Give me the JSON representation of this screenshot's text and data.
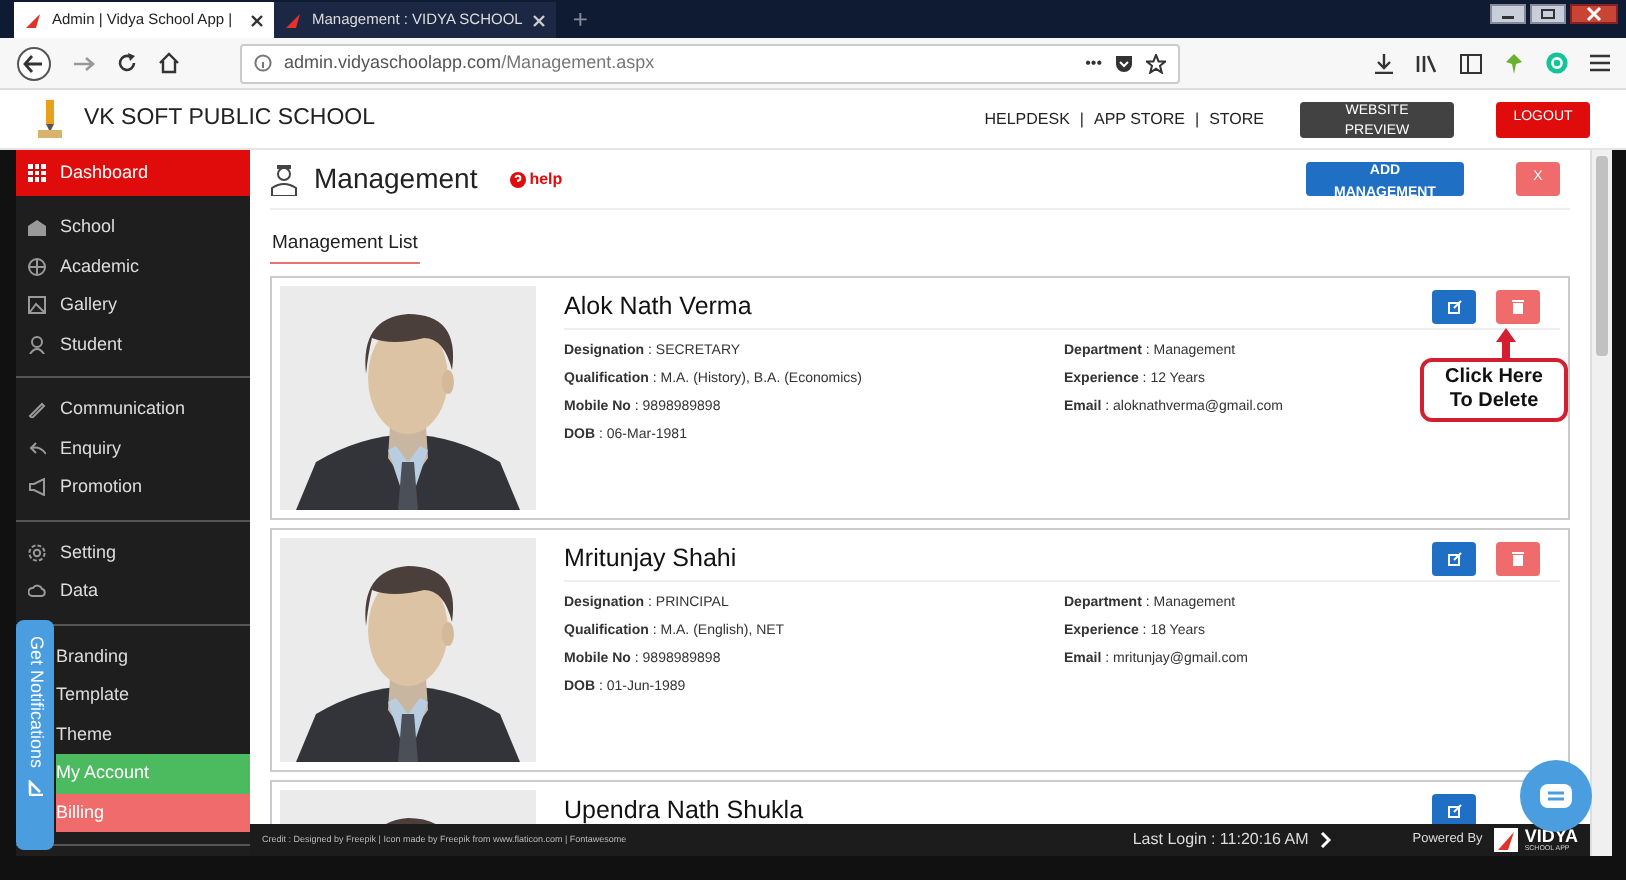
{
  "browser": {
    "tabs": [
      {
        "title": "Admin | Vidya School App |",
        "selected": true
      },
      {
        "title": "Management : VIDYA SCHOOL",
        "selected": false
      }
    ],
    "new_tab": "+",
    "url_host": "admin.vidyaschoolapp.com",
    "url_path": "/Management.aspx",
    "url_dots": "•••"
  },
  "header": {
    "school_name": "VK SOFT PUBLIC SCHOOL",
    "links": [
      "HELPDESK",
      "APP STORE",
      "STORE"
    ],
    "separator": "|",
    "preview_button": "WEBSITE PREVIEW",
    "logout_button": "LOGOUT"
  },
  "sidebar": {
    "groups": [
      [
        {
          "label": "Dashboard",
          "selected": true
        }
      ],
      [
        {
          "label": "School",
          "selected": false
        },
        {
          "label": "Academic",
          "selected": false
        },
        {
          "label": "Gallery",
          "selected": false
        },
        {
          "label": "Student",
          "selected": false
        }
      ],
      [
        {
          "label": "Communication",
          "selected": false
        },
        {
          "label": "Enquiry",
          "selected": false
        },
        {
          "label": "Promotion",
          "selected": false
        }
      ],
      [
        {
          "label": "Setting",
          "selected": false
        },
        {
          "label": "Data",
          "selected": false
        }
      ],
      [
        {
          "label": "Branding",
          "selected": false
        },
        {
          "label": "Template",
          "selected": false
        },
        {
          "label": "Theme",
          "selected": false
        },
        {
          "label": "My Account",
          "selected": false,
          "color": "#4cbb5f"
        },
        {
          "label": "Billing",
          "selected": false,
          "color": "#f06b6b"
        }
      ]
    ]
  },
  "notifications_tab": "Get Notifications",
  "page": {
    "title": "Management",
    "help": "help",
    "add_button": "ADD MANAGEMENT",
    "close_button": "X",
    "section": "Management List",
    "members": [
      {
        "name": "Alok Nath Verma",
        "left": [
          {
            "label": "Designation",
            "value": "SECRETARY"
          },
          {
            "label": "Qualification",
            "value": "M.A. (History), B.A. (Economics)"
          },
          {
            "label": "Mobile No",
            "value": "9898989898"
          },
          {
            "label": "DOB",
            "value": "06-Mar-1981"
          }
        ],
        "right": [
          {
            "label": "Department",
            "value": "Management"
          },
          {
            "label": "Experience",
            "value": "12 Years"
          },
          {
            "label": "Email",
            "value": "aloknathverma@gmail.com"
          }
        ],
        "callout": "Click Here To Delete"
      },
      {
        "name": "Mritunjay Shahi",
        "left": [
          {
            "label": "Designation",
            "value": "PRINCIPAL"
          },
          {
            "label": "Qualification",
            "value": "M.A. (English), NET"
          },
          {
            "label": "Mobile No",
            "value": "9898989898"
          },
          {
            "label": "DOB",
            "value": "01-Jun-1989"
          }
        ],
        "right": [
          {
            "label": "Department",
            "value": "Management"
          },
          {
            "label": "Experience",
            "value": "18 Years"
          },
          {
            "label": "Email",
            "value": "mritunjay@gmail.com"
          }
        ]
      },
      {
        "name": "Upendra Nath Shukla"
      }
    ],
    "field_separator": ":"
  },
  "footer": {
    "credit": "Credit : Designed by Freepik | Icon made by Freepik from www.flaticon.com | Fontawesome",
    "last_login": "Last Login : 11:20:16 AM",
    "powered_by": "Powered By",
    "logo_name": "VIDYA",
    "logo_sub": "SCHOOL APP"
  }
}
